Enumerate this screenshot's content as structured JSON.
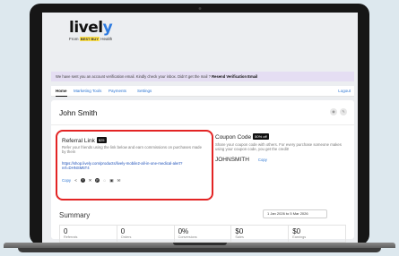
{
  "brand": {
    "logo_main": "livel",
    "logo_y": "y",
    "from_prefix": "From",
    "from_brand": "BEST BUY",
    "from_suffix": "Health"
  },
  "notice": {
    "text": "We have sent you an account verification email. Kindly check your inbox. Didn't get the mail ?",
    "link": "Resend Verification Email"
  },
  "tabs": [
    "Home",
    "Marketing Tools",
    "Payments",
    "Settings"
  ],
  "logout": "Logout",
  "user": {
    "name": "John Smith"
  },
  "referral": {
    "title": "Referral Link",
    "badge": "$25",
    "description": "Refer your friends using the link below and earn commissions on purchases made by them",
    "link": "https://shop.lively.com/products/lively-mobile2-all-in-one-medical-alert?ref=DHNSM5T4",
    "copy_label": "Copy",
    "share_icons": [
      "share-icon",
      "facebook-icon",
      "x-icon",
      "pinterest-icon",
      "whatsapp-icon",
      "sms-icon",
      "email-icon"
    ]
  },
  "coupon": {
    "title": "Coupon Code",
    "badge": "50% off",
    "description": "Share your coupon code with others. For every purchase someone makes using your coupon code, you get the credit!",
    "code": "JOHNSMITH",
    "copy_label": "Copy"
  },
  "summary": {
    "title": "Summary",
    "date_range": "1 Jan 2026 to 5 Mar 2026",
    "stats": [
      {
        "value": "0",
        "label": "Referrals"
      },
      {
        "value": "0",
        "label": "Orders"
      },
      {
        "value": "0%",
        "label": "Conversions"
      },
      {
        "value": "$0",
        "label": "Sales"
      },
      {
        "value": "$0",
        "label": "Earnings"
      }
    ]
  },
  "colors": {
    "accent": "#2b74d2",
    "highlight": "#e32424",
    "notice_bg": "#e5def3"
  }
}
